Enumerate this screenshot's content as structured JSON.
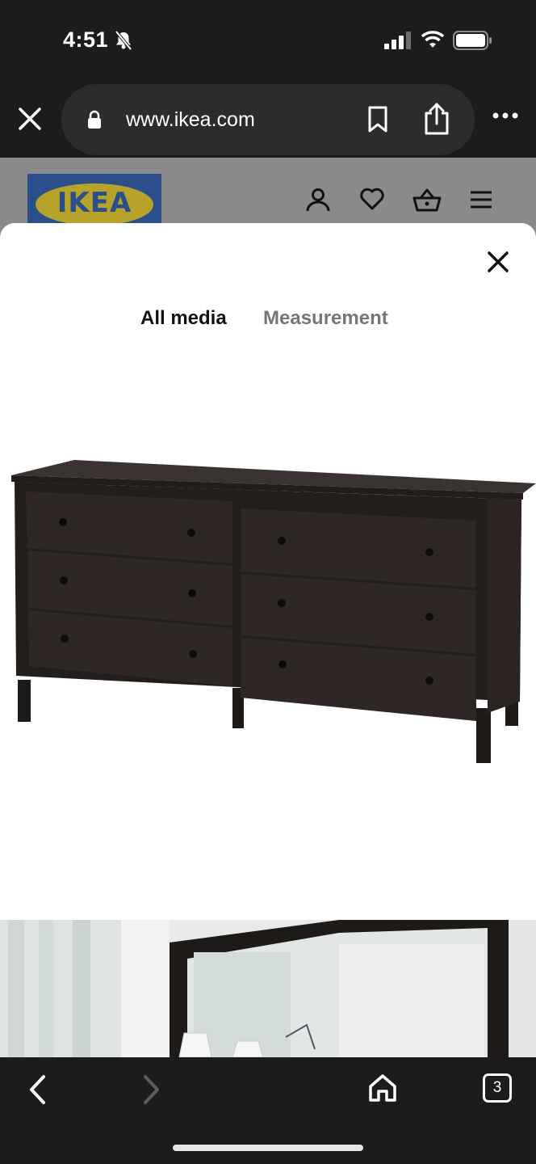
{
  "status_bar": {
    "time": "4:51"
  },
  "browser": {
    "url": "www.ikea.com",
    "tab_count": "3"
  },
  "site": {
    "logo_text": "IKEA",
    "colors": {
      "logo_blue": "#2a4f8a",
      "logo_yellow": "#b8a32a"
    }
  },
  "modal": {
    "tabs": [
      {
        "label": "All media",
        "active": true
      },
      {
        "label": "Measurement",
        "active": false
      }
    ]
  },
  "icons": {
    "status": [
      "bell-slash-icon",
      "signal-icon",
      "wifi-icon",
      "battery-icon"
    ],
    "browser_top": [
      "close-icon",
      "lock-icon",
      "bookmark-icon",
      "share-icon",
      "more-icon"
    ],
    "site_header": [
      "account-icon",
      "heart-icon",
      "basket-icon",
      "menu-icon"
    ],
    "browser_bottom": [
      "back-icon",
      "forward-icon",
      "home-icon",
      "tabs-icon"
    ]
  }
}
